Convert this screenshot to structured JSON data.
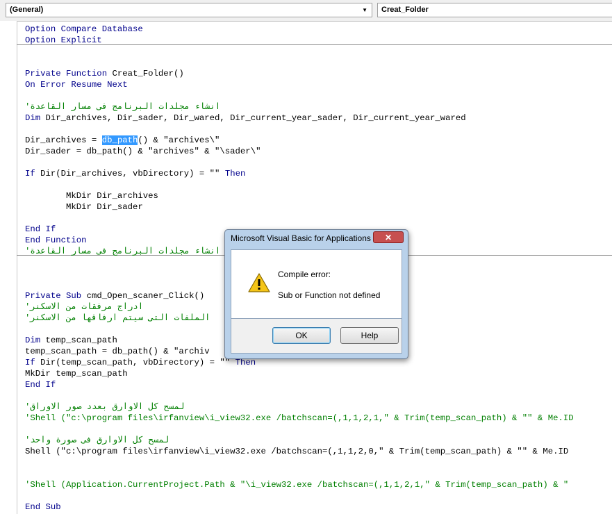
{
  "header": {
    "object_combo": "(General)",
    "procedure_combo": "Creat_Folder"
  },
  "code": {
    "l1_kw": "Option Compare Database",
    "l2_kw": "Option Explicit",
    "l3_kw": "Private Function",
    "l3_tx": " Creat_Folder()",
    "l4_kw": "On Error Resume Next",
    "l5_cm": "'انشاء مجلدات البرنامج فى مسار القاعدة",
    "l6_kw": "Dim",
    "l6_tx": " Dir_archives, Dir_sader, Dir_wared, Dir_current_year_sader, Dir_current_year_wared",
    "l7_a": "Dir_archives = ",
    "l7_sel": "db_path",
    "l7_b": "() & \"archives\\\"",
    "l8": "Dir_sader = db_path() & \"archives\" & \"\\sader\\\"",
    "l9_kw1": "If",
    "l9_tx": " Dir(Dir_archives, vbDirectory) = \"\" ",
    "l9_kw2": "Then",
    "l10": "        MkDir Dir_archives",
    "l11": "        MkDir Dir_sader",
    "l12_kw": "End If",
    "l13_kw": "End Function",
    "l14_cm": "'انشاء مجلدات البرنامج فى مسار القاعدة",
    "l15_kw": "Private Sub",
    "l15_tx": " cmd_Open_scaner_Click()",
    "l16_cm": "'ادراج مرفقات من الاسكنر",
    "l17_cm": "'الملفات التى سيتم ارفاقها من الاسكنر",
    "l18_kw": "Dim",
    "l18_tx": " temp_scan_path",
    "l19": "temp_scan_path = db_path() & \"archiv",
    "l20_kw1": "If",
    "l20_tx": " Dir(temp_scan_path, vbDirectory) = \"\" ",
    "l20_kw2": "Then",
    "l21": "MkDir temp_scan_path",
    "l22_kw": "End If",
    "l23_cm": "'لمسح كل الاوارق بعدد صور الاوراق",
    "l24_cm": "'Shell (\"c:\\program files\\irfanview\\i_view32.exe /batchscan=(,1,1,2,1,\" & Trim(temp_scan_path) & \"\" & Me.ID",
    "l25_cm": "'لمسح كل الاوارق فى صورة واحد",
    "l26": "Shell (\"c:\\program files\\irfanview\\i_view32.exe /batchscan=(,1,1,2,0,\" & Trim(temp_scan_path) & \"\" & Me.ID",
    "l27_cm": "'Shell (Application.CurrentProject.Path & \"\\i_view32.exe /batchscan=(,1,1,2,1,\" & Trim(temp_scan_path) & \"",
    "l28_kw": "End Sub"
  },
  "dialog": {
    "title": "Microsoft Visual Basic for Applications",
    "close_label": "✕",
    "icon": "warning-icon",
    "heading": "Compile error:",
    "message": "Sub or Function not defined",
    "ok_label": "OK",
    "help_label": "Help"
  }
}
